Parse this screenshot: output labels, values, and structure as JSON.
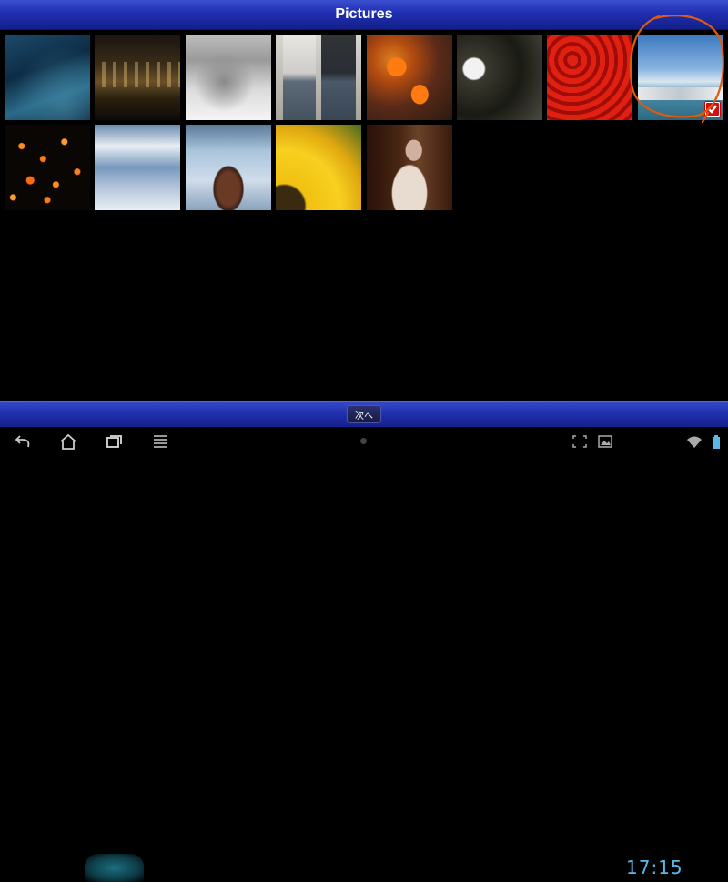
{
  "header": {
    "title": "Pictures"
  },
  "gallery": {
    "thumbnails": [
      {
        "name": "thumb-lake",
        "selected": false
      },
      {
        "name": "thumb-night-building",
        "selected": false
      },
      {
        "name": "thumb-sleeping-cat",
        "selected": false
      },
      {
        "name": "thumb-couple-walking",
        "selected": false
      },
      {
        "name": "thumb-clownfish",
        "selected": false
      },
      {
        "name": "thumb-white-flower",
        "selected": false
      },
      {
        "name": "thumb-red-lanterns",
        "selected": false
      },
      {
        "name": "thumb-harbor-boats",
        "selected": true
      },
      {
        "name": "thumb-sky-lanterns",
        "selected": false
      },
      {
        "name": "thumb-cloudy-sky",
        "selected": false
      },
      {
        "name": "thumb-rock-sea",
        "selected": false
      },
      {
        "name": "thumb-sunflower",
        "selected": false
      },
      {
        "name": "thumb-woman-portrait",
        "selected": false
      }
    ]
  },
  "footer": {
    "next_label": "次へ"
  },
  "status": {
    "time": "17:15"
  },
  "colors": {
    "accent": "#1f2fb0",
    "selection_circle": "#e05a10",
    "check": "#d01010",
    "clock": "#5ab8e8"
  }
}
